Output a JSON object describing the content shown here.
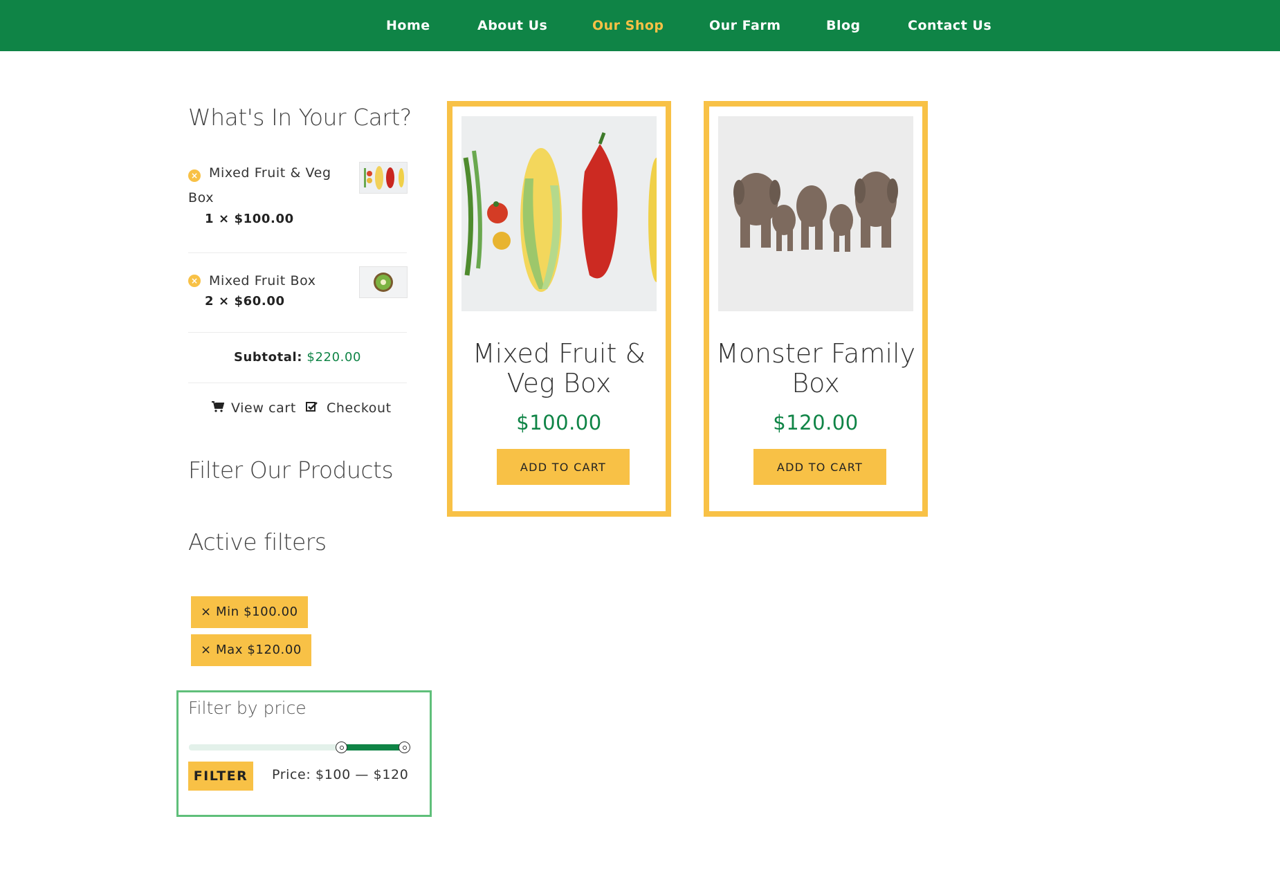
{
  "nav": {
    "items": [
      {
        "label": "Home"
      },
      {
        "label": "About Us"
      },
      {
        "label": "Our Shop"
      },
      {
        "label": "Our Farm"
      },
      {
        "label": "Blog"
      },
      {
        "label": "Contact Us"
      }
    ],
    "active": "Our Shop"
  },
  "cart": {
    "title": "What's In Your Cart?",
    "items": [
      {
        "name": "Mixed Fruit & Veg Box",
        "qty": "1 × $100.00"
      },
      {
        "name": "Mixed Fruit Box",
        "qty": "2 × $60.00"
      }
    ],
    "subtotal_label": "Subtotal:",
    "subtotal_value": "$220.00",
    "view_cart": "View cart",
    "checkout": "Checkout"
  },
  "filters": {
    "title": "Filter Our Products",
    "active_title": "Active filters",
    "active": [
      "Min $100.00",
      "Max $120.00"
    ]
  },
  "price_filter": {
    "title": "Filter by price",
    "button": "FILTER",
    "price_label": "Price:",
    "price_range": "$100 — $120",
    "slider_min_fraction": 0.75,
    "slider_max_fraction": 1.0
  },
  "products": [
    {
      "name": "Mixed Fruit & Veg Box",
      "price": "$100.00",
      "button": "ADD TO CART"
    },
    {
      "name": "Monster Family Box",
      "price": "$120.00",
      "button": "ADD TO CART"
    }
  ],
  "colors": {
    "brand_green": "#0f8446",
    "accent_yellow": "#f8c146",
    "filter_border": "#5fbf7a"
  }
}
